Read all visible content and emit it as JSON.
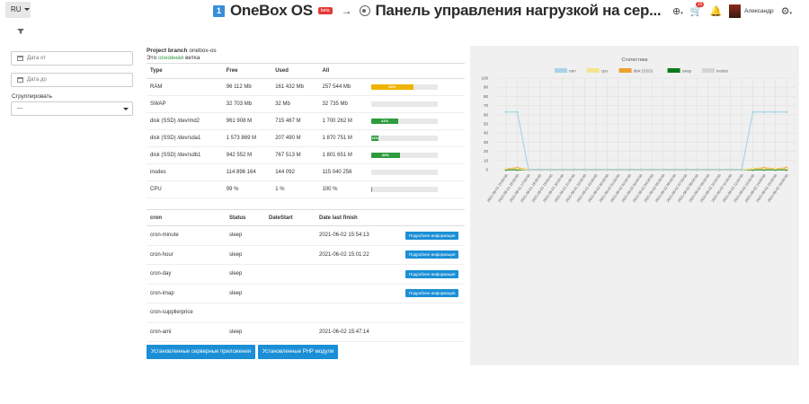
{
  "header": {
    "lang": "RU",
    "brand_num": "1",
    "brand_title": "OneBox OS",
    "beta": "beta",
    "arrow": "→",
    "subtitle": "Панель управления нагрузкой на сер...",
    "notif_count": "15",
    "user_name": "Александр"
  },
  "filters": {
    "date_from_placeholder": "Дата от",
    "date_to_placeholder": "Дата до",
    "group_label": "Сгруппировать",
    "group_value": "---"
  },
  "branch": {
    "label": "Project branch",
    "name": "onebox-os",
    "main_prefix": "Это",
    "main_word": "основная",
    "main_suffix": "ветка"
  },
  "resources": {
    "headers": [
      "Type",
      "Free",
      "Used",
      "All"
    ],
    "rows": [
      {
        "type": "RAM",
        "free": "96 112 Mb",
        "used": "161 432 Mb",
        "all": "257 544 Mb",
        "pct": 63,
        "pct_label": "63%",
        "color": "#f0b400"
      },
      {
        "type": "SWAP",
        "free": "32 703 Mb",
        "used": "32 Mb",
        "all": "32 735 Mb",
        "pct": 0,
        "pct_label": "",
        "color": "#2e9c3e"
      },
      {
        "type": "disk (SSD) /dev/md2",
        "free": "961 908 M",
        "used": "715 467 M",
        "all": "1 700 262 M",
        "pct": 41,
        "pct_label": "41%",
        "color": "#2e9c3e"
      },
      {
        "type": "disk (SSD) /dev/sda1",
        "free": "1 573 869 M",
        "used": "207 490 M",
        "all": "1 870 751 M",
        "pct": 11,
        "pct_label": "11%",
        "color": "#2e9c3e"
      },
      {
        "type": "disk (SSD) /dev/sdb1",
        "free": "942 552 M",
        "used": "767 513 M",
        "all": "1 801 651 M",
        "pct": 43,
        "pct_label": "43%",
        "color": "#2e9c3e"
      },
      {
        "type": "inodes",
        "free": "114 896 164",
        "used": "144 092",
        "all": "115 040 256",
        "pct": 0,
        "pct_label": "",
        "color": "#2e9c3e"
      },
      {
        "type": "CPU",
        "free": "99 %",
        "used": "1 %",
        "all": "100 %",
        "pct": 1,
        "pct_label": "",
        "color": "#888888"
      }
    ]
  },
  "cron": {
    "headers": [
      "cron",
      "Status",
      "DateStart",
      "Date last finish"
    ],
    "more_label": "Подробнее информация",
    "rows": [
      {
        "name": "cron-minute",
        "status": "sleep",
        "start": "",
        "finish": "2021-06-02 15:54:13",
        "more": true
      },
      {
        "name": "cron-hour",
        "status": "sleep",
        "start": "",
        "finish": "2021-06-02 15:01:22",
        "more": true
      },
      {
        "name": "cron-day",
        "status": "sleep",
        "start": "",
        "finish": "",
        "more": true
      },
      {
        "name": "cron-imap",
        "status": "sleep",
        "start": "",
        "finish": "",
        "more": true
      },
      {
        "name": "cron-supplierprice",
        "status": "",
        "start": "",
        "finish": "",
        "more": false
      },
      {
        "name": "cron-ami",
        "status": "sleep",
        "start": "",
        "finish": "2021-06-02 15:47:14",
        "more": false
      }
    ]
  },
  "buttons": {
    "apps": "Установленные серверные приложения",
    "php": "Установленные PHP модули"
  },
  "chart_data": {
    "type": "line",
    "title": "Статистика",
    "legend": [
      "ram",
      "cpu",
      "disk (SSD)",
      "swap",
      "inodes"
    ],
    "legend_position": "top",
    "colors": [
      "#a9d4ea",
      "#f5e38a",
      "#f0a030",
      "#0b7a1a",
      "#d4d4d4"
    ],
    "ylim": [
      0,
      100
    ],
    "yticks": [
      0,
      10,
      20,
      30,
      40,
      50,
      60,
      70,
      80,
      90,
      100
    ],
    "grid": true,
    "x": [
      "2021-06-01 15:00:00",
      "2021-06-01 16:00:00",
      "2021-06-01 17:00:00",
      "2021-06-01 18:00:00",
      "2021-06-01 19:00:00",
      "2021-06-01 20:00:00",
      "2021-06-01 21:00:00",
      "2021-06-01 22:00:00",
      "2021-06-01 23:00:00",
      "2021-06-02 00:00:00",
      "2021-06-02 01:00:00",
      "2021-06-02 02:00:00",
      "2021-06-02 03:00:00",
      "2021-06-02 04:00:00",
      "2021-06-02 05:00:00",
      "2021-06-02 06:00:00",
      "2021-06-02 07:00:00",
      "2021-06-02 08:00:00",
      "2021-06-02 09:00:00",
      "2021-06-02 10:00:00",
      "2021-06-02 11:00:00",
      "2021-06-02 12:00:00",
      "2021-06-02 13:00:00",
      "2021-06-02 14:00:00",
      "2021-06-02 15:00:00",
      "2021-06-02 16:00:00"
    ],
    "series": [
      {
        "name": "ram",
        "values": [
          63,
          63,
          0,
          0,
          0,
          0,
          0,
          0,
          0,
          0,
          0,
          0,
          0,
          0,
          0,
          0,
          0,
          0,
          0,
          0,
          0,
          0,
          63,
          63,
          63,
          63
        ]
      },
      {
        "name": "cpu",
        "values": [
          1,
          1,
          0,
          0,
          0,
          0,
          0,
          0,
          0,
          0,
          0,
          0,
          0,
          0,
          0,
          0,
          0,
          0,
          0,
          0,
          0,
          0,
          1,
          1,
          1,
          1
        ]
      },
      {
        "name": "disk (SSD)",
        "values": [
          1,
          2,
          0,
          0,
          0,
          0,
          0,
          0,
          0,
          0,
          0,
          0,
          0,
          0,
          0,
          0,
          0,
          0,
          0,
          0,
          0,
          0,
          1,
          2,
          1,
          2
        ]
      },
      {
        "name": "swap",
        "values": [
          0,
          0,
          0,
          0,
          0,
          0,
          0,
          0,
          0,
          0,
          0,
          0,
          0,
          0,
          0,
          0,
          0,
          0,
          0,
          0,
          0,
          0,
          0,
          0,
          0,
          0
        ]
      },
      {
        "name": "inodes",
        "values": [
          0,
          0,
          0,
          0,
          0,
          0,
          0,
          0,
          0,
          0,
          0,
          0,
          0,
          0,
          0,
          0,
          0,
          0,
          0,
          0,
          0,
          0,
          0,
          0,
          0,
          0
        ]
      }
    ]
  }
}
